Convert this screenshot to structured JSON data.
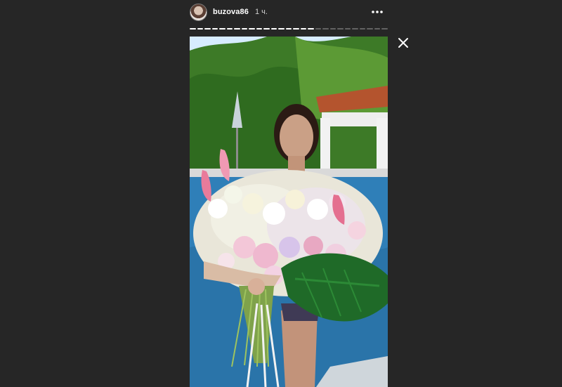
{
  "story": {
    "username": "buzova86",
    "timestamp": "1 ч.",
    "progress_segments_total": 27,
    "progress_segments_viewed": 17,
    "accent_color": "#ffffff",
    "background_color": "#262626"
  },
  "icons": {
    "more": "more-horizontal-icon",
    "close": "close-icon"
  }
}
